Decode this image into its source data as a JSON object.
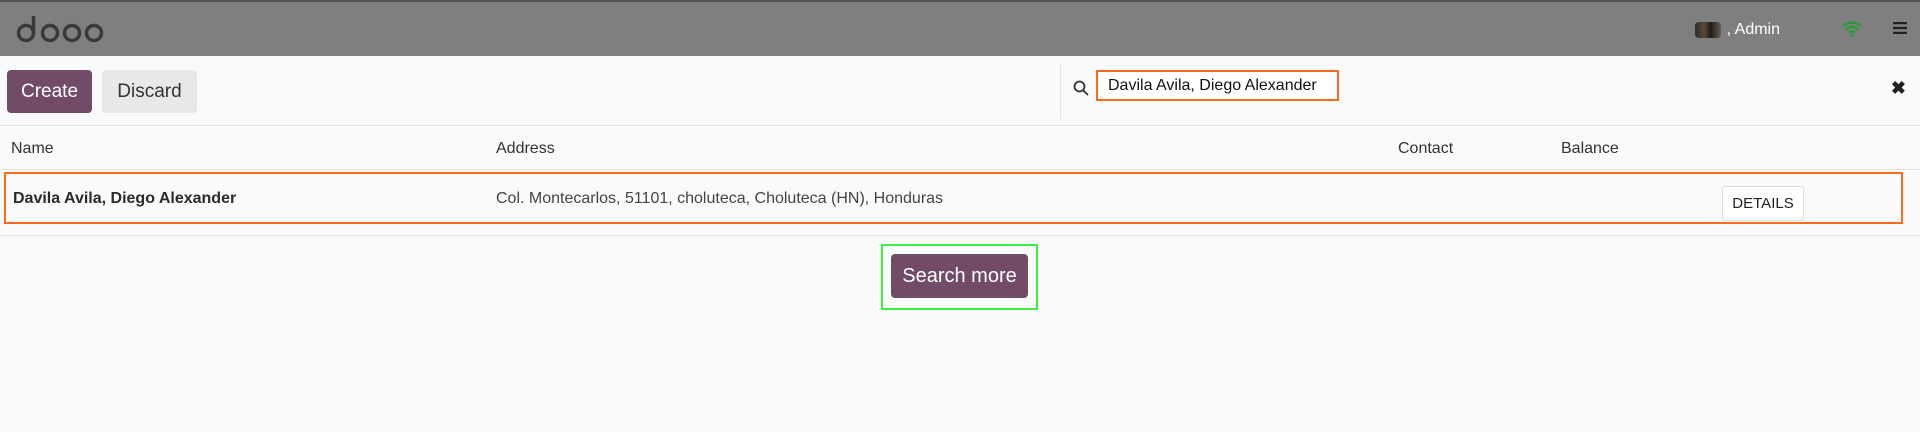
{
  "header": {
    "logo_text": "odoo",
    "user_name": ", Admin"
  },
  "toolbar": {
    "create_label": "Create",
    "discard_label": "Discard"
  },
  "search": {
    "value": "Davila Avila, Diego Alexander"
  },
  "table": {
    "columns": [
      "Name",
      "Address",
      "Contact",
      "Balance"
    ],
    "rows": [
      {
        "name": "Davila Avila, Diego Alexander",
        "address": "Col. Montecarlos, 51101, choluteca, Choluteca (HN), Honduras",
        "contact": "",
        "balance": "",
        "details_label": "DETAILS"
      }
    ]
  },
  "search_more_label": "Search more",
  "colors": {
    "primary": "#714b67",
    "topbar": "#7f7f7f",
    "highlight_orange": "#ff6a1a",
    "highlight_green": "#3ef03e"
  },
  "icons": [
    "odoo-logo",
    "avatar",
    "wifi-icon",
    "hamburger-menu-icon",
    "search-icon",
    "close-icon"
  ]
}
